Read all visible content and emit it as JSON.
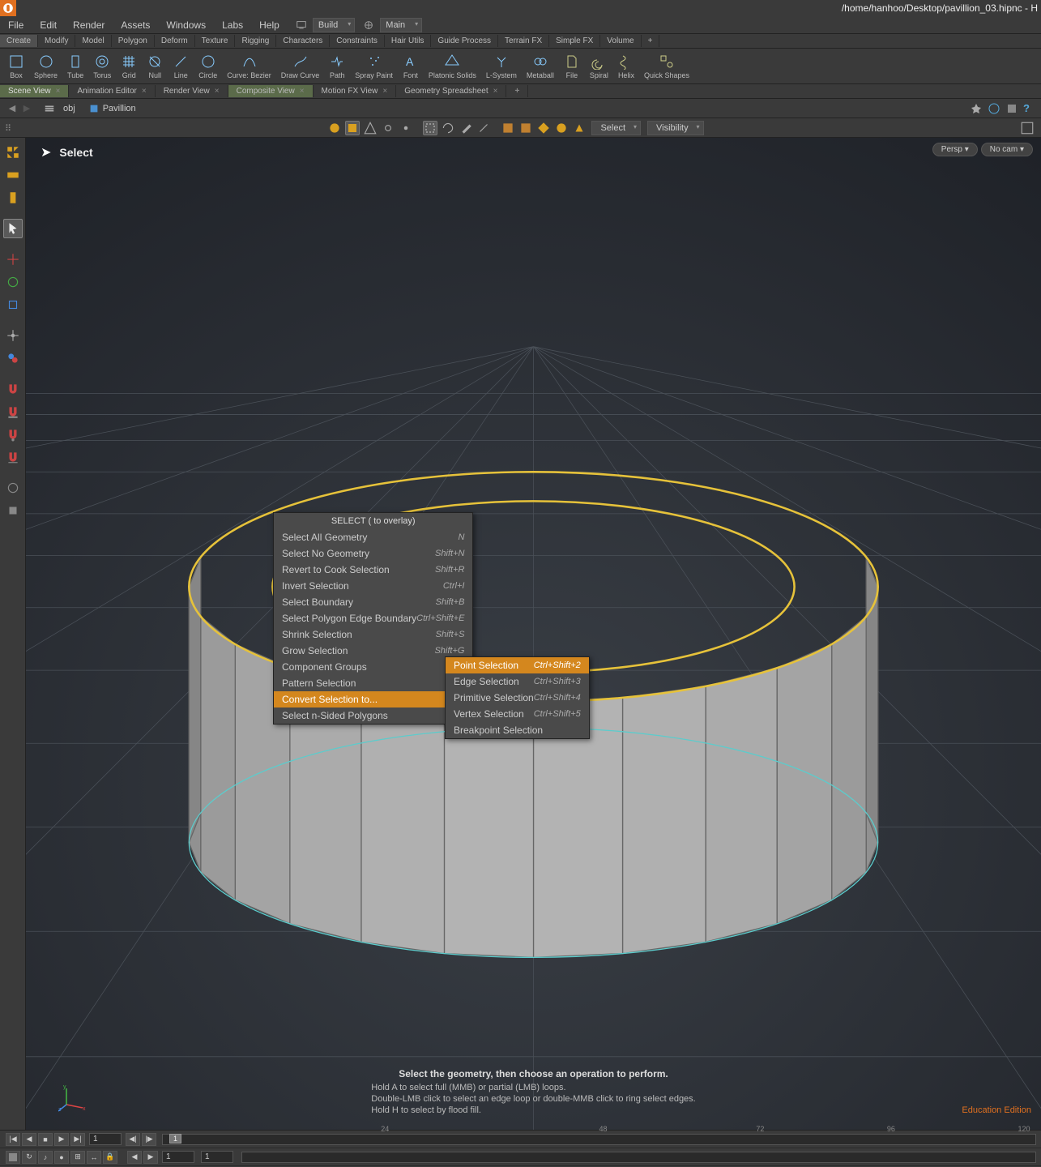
{
  "titlebar": {
    "path": "/home/hanhoo/Desktop/pavillion_03.hipnc - H"
  },
  "menubar": {
    "items": [
      "File",
      "Edit",
      "Render",
      "Assets",
      "Windows",
      "Labs",
      "Help"
    ],
    "dropdowns": {
      "build": "Build",
      "main": "Main"
    }
  },
  "shelf_tabs": [
    "Create",
    "Modify",
    "Model",
    "Polygon",
    "Deform",
    "Texture",
    "Rigging",
    "Characters",
    "Constraints",
    "Hair Utils",
    "Guide Process",
    "Terrain FX",
    "Simple FX",
    "Volume"
  ],
  "shelf_tools": [
    {
      "label": "Box",
      "icon": "box"
    },
    {
      "label": "Sphere",
      "icon": "sphere"
    },
    {
      "label": "Tube",
      "icon": "tube"
    },
    {
      "label": "Torus",
      "icon": "torus"
    },
    {
      "label": "Grid",
      "icon": "grid"
    },
    {
      "label": "Null",
      "icon": "null"
    },
    {
      "label": "Line",
      "icon": "line"
    },
    {
      "label": "Circle",
      "icon": "circle"
    },
    {
      "label": "Curve: Bezier",
      "icon": "curve"
    },
    {
      "label": "Draw Curve",
      "icon": "draw"
    },
    {
      "label": "Path",
      "icon": "path"
    },
    {
      "label": "Spray Paint",
      "icon": "spray"
    },
    {
      "label": "Font",
      "icon": "font"
    },
    {
      "label": "Platonic Solids",
      "icon": "platonic"
    },
    {
      "label": "L-System",
      "icon": "lsystem"
    },
    {
      "label": "Metaball",
      "icon": "metaball"
    },
    {
      "label": "File",
      "icon": "file"
    },
    {
      "label": "Spiral",
      "icon": "spiral"
    },
    {
      "label": "Helix",
      "icon": "helix"
    },
    {
      "label": "Quick Shapes",
      "icon": "quick"
    }
  ],
  "panel_tabs": [
    {
      "label": "Scene View",
      "active": true,
      "closable": true
    },
    {
      "label": "Animation Editor",
      "closable": true
    },
    {
      "label": "Render View",
      "closable": true
    },
    {
      "label": "Composite View",
      "composite": true,
      "closable": true
    },
    {
      "label": "Motion FX View",
      "closable": true
    },
    {
      "label": "Geometry Spreadsheet",
      "closable": true
    }
  ],
  "breadcrumb": {
    "root": "obj",
    "node": "Pavillion"
  },
  "viewport_toolbar": {
    "select_dropdown": "Select",
    "visibility_dropdown": "Visibility"
  },
  "viewport": {
    "mode_title": "Select",
    "persp": "Persp",
    "cam": "No cam",
    "hint_main": "Select the geometry, then choose an operation to perform.",
    "hint_lines": [
      "Hold A to select full (MMB) or partial (LMB) loops.",
      "Double-LMB click to select an edge loop or double-MMB click to ring select edges.",
      "Hold H to select by flood fill."
    ],
    "edition": "Education Edition"
  },
  "context_menu": {
    "title": "SELECT ( to overlay)",
    "items": [
      {
        "label": "Select All Geometry",
        "shortcut": "N"
      },
      {
        "label": "Select No Geometry",
        "shortcut": "Shift+N"
      },
      {
        "label": "Revert to Cook Selection",
        "shortcut": "Shift+R"
      },
      {
        "label": "Invert Selection",
        "shortcut": "Ctrl+I"
      },
      {
        "label": "Select Boundary",
        "shortcut": "Shift+B"
      },
      {
        "label": "Select Polygon Edge Boundary",
        "shortcut": "Ctrl+Shift+E"
      },
      {
        "label": "Shrink Selection",
        "shortcut": "Shift+S"
      },
      {
        "label": "Grow Selection",
        "shortcut": "Shift+G"
      },
      {
        "label": "Component Groups",
        "submenu": true
      },
      {
        "label": "Pattern Selection",
        "submenu": true
      },
      {
        "label": "Convert Selection to...",
        "submenu": true,
        "highlighted": true
      },
      {
        "label": "Select n-Sided Polygons",
        "submenu": true
      }
    ]
  },
  "submenu": {
    "items": [
      {
        "label": "Point Selection",
        "shortcut": "Ctrl+Shift+2",
        "highlighted": true
      },
      {
        "label": "Edge Selection",
        "shortcut": "Ctrl+Shift+3"
      },
      {
        "label": "Primitive Selection",
        "shortcut": "Ctrl+Shift+4"
      },
      {
        "label": "Vertex Selection",
        "shortcut": "Ctrl+Shift+5"
      },
      {
        "label": "Breakpoint Selection",
        "shortcut": ""
      }
    ]
  },
  "timeline": {
    "frame": "1",
    "range_start": "1",
    "range_end": "1",
    "ticks": [
      {
        "pos": 25,
        "label": "24"
      },
      {
        "pos": 50,
        "label": "48"
      },
      {
        "pos": 68,
        "label": "72"
      },
      {
        "pos": 83,
        "label": "96"
      },
      {
        "pos": 98,
        "label": "120"
      }
    ],
    "current_marker": "1"
  }
}
